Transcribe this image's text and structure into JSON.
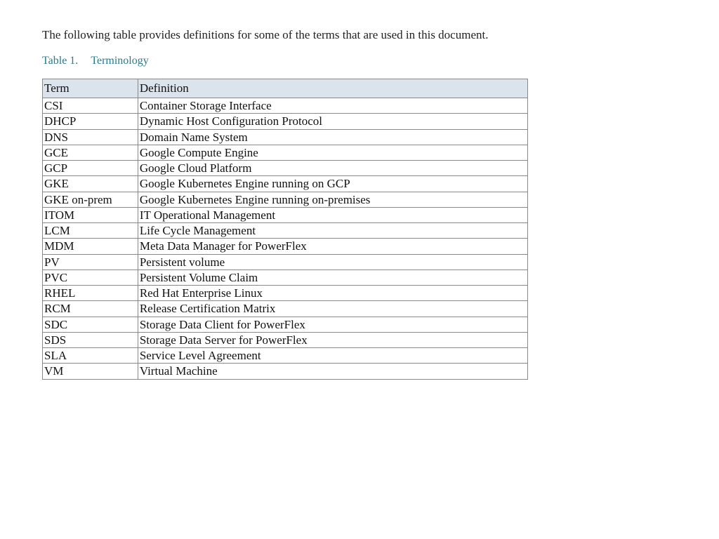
{
  "intro": "The following table provides definitions for some of the terms that are used in this document.",
  "caption": {
    "number": "Table 1.",
    "title": "Terminology"
  },
  "headers": {
    "term": "Term",
    "definition": "Definition"
  },
  "rows": [
    {
      "term": "CSI",
      "definition": "Container Storage Interface"
    },
    {
      "term": "DHCP",
      "definition": "Dynamic Host Configuration Protocol"
    },
    {
      "term": "DNS",
      "definition": "Domain Name System"
    },
    {
      "term": "GCE",
      "definition": "Google Compute Engine"
    },
    {
      "term": "GCP",
      "definition": "Google Cloud Platform"
    },
    {
      "term": "GKE",
      "definition": "Google Kubernetes Engine running on GCP"
    },
    {
      "term": "GKE on-prem",
      "definition": "Google Kubernetes Engine running on-premises"
    },
    {
      "term": "ITOM",
      "definition": "IT Operational Management"
    },
    {
      "term": "LCM",
      "definition": "Life Cycle Management"
    },
    {
      "term": "MDM",
      "definition": "Meta Data Manager for PowerFlex"
    },
    {
      "term": "PV",
      "definition": "Persistent volume"
    },
    {
      "term": "PVC",
      "definition": "Persistent Volume Claim"
    },
    {
      "term": "RHEL",
      "definition": "Red Hat Enterprise Linux"
    },
    {
      "term": "RCM",
      "definition": "Release Certification Matrix"
    },
    {
      "term": "SDC",
      "definition": "Storage Data Client for PowerFlex"
    },
    {
      "term": "SDS",
      "definition": "Storage Data Server for PowerFlex"
    },
    {
      "term": "SLA",
      "definition": "Service Level Agreement"
    },
    {
      "term": "VM",
      "definition": "Virtual Machine"
    }
  ]
}
